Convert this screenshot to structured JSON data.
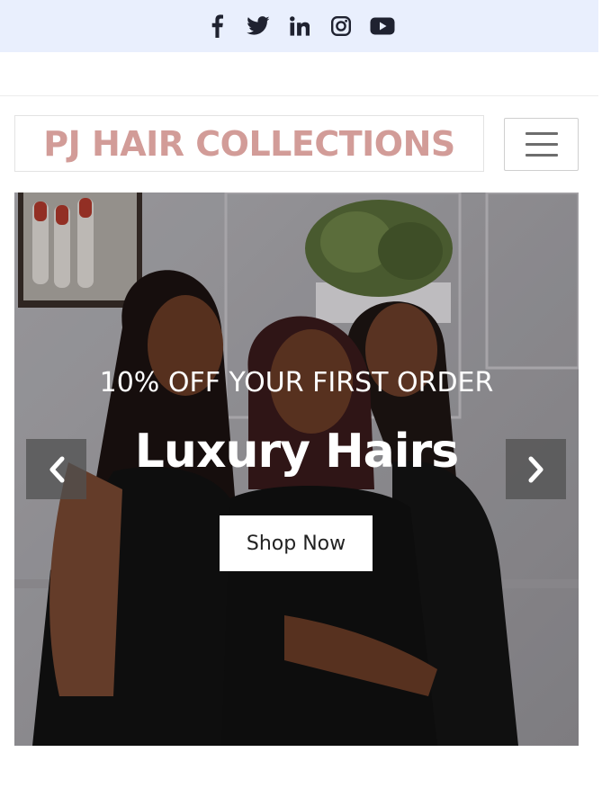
{
  "social": {
    "icons": [
      "facebook-icon",
      "twitter-icon",
      "linkedin-icon",
      "instagram-icon",
      "youtube-icon"
    ]
  },
  "brand": {
    "name": "PJ HAIR COLLECTIONS",
    "color": "#d29c98"
  },
  "menu": {
    "icon": "hamburger-icon"
  },
  "hero": {
    "eyebrow": "10% OFF YOUR FIRST ORDER",
    "title": "Luxury Hairs",
    "button_label": "Shop Now",
    "prev_icon": "chevron-left-icon",
    "next_icon": "chevron-right-icon"
  },
  "colors": {
    "social_bar_bg": "#e9effd",
    "icon_color": "#1f2230"
  }
}
